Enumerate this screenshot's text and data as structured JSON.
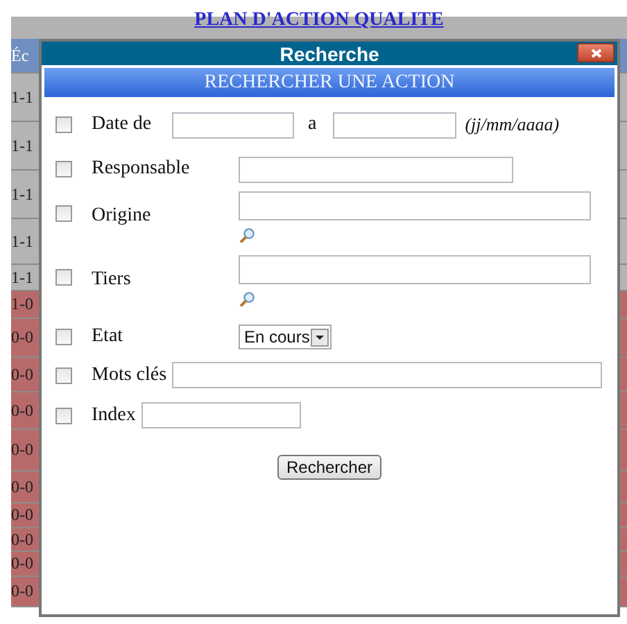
{
  "page_title": "PLAN D'ACTION QUALITE",
  "background_rows": [
    {
      "kind": "header",
      "left": "Éc"
    },
    {
      "kind": "grey",
      "left": "1-1"
    },
    {
      "kind": "grey",
      "left": "1-1"
    },
    {
      "kind": "grey",
      "left": "1-1"
    },
    {
      "kind": "grey",
      "left": "1-1"
    },
    {
      "kind": "grey",
      "left": "1-1"
    },
    {
      "kind": "red",
      "left": "1-0"
    },
    {
      "kind": "red",
      "left": "0-0"
    },
    {
      "kind": "red",
      "left": "0-0"
    },
    {
      "kind": "red",
      "left": "0-0"
    },
    {
      "kind": "red",
      "left": "0-0"
    },
    {
      "kind": "red",
      "left": "0-0"
    },
    {
      "kind": "red",
      "left": "0-0"
    },
    {
      "kind": "red",
      "left": "0-0"
    },
    {
      "kind": "red",
      "left": "0-0"
    },
    {
      "kind": "red",
      "left": "0-0"
    }
  ],
  "dialog": {
    "title": "Recherche",
    "heading": "RECHERCHER UNE ACTION",
    "criteria": [
      {
        "kind": "date-range",
        "label": "Date de",
        "between": "a",
        "hint": "(jj/mm/aaaa)",
        "checked": false
      },
      {
        "kind": "text",
        "label": "Responsable",
        "checked": false
      },
      {
        "kind": "lookup",
        "label": "Origine",
        "checked": false
      },
      {
        "kind": "lookup",
        "label": "Tiers",
        "checked": false
      },
      {
        "kind": "select",
        "label": "Etat",
        "value": "En cours",
        "checked": false
      },
      {
        "kind": "wide",
        "label": "Mots clés",
        "checked": false
      },
      {
        "kind": "short",
        "label": "Index",
        "checked": false
      }
    ],
    "button": "Rechercher"
  }
}
